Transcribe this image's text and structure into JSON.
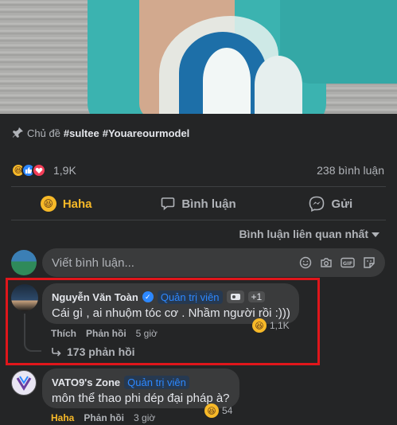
{
  "post": {
    "topic_label": "Chủ đề",
    "tags": [
      "#sultee",
      "#Youareourmodel"
    ],
    "reaction_count": "1,9K",
    "comment_count": "238 bình luận",
    "reaction_icons": [
      "haha-icon",
      "like-icon",
      "love-icon"
    ]
  },
  "actions": {
    "haha": "Haha",
    "comment": "Bình luận",
    "send": "Gửi"
  },
  "sort": {
    "label": "Bình luận liên quan nhất"
  },
  "compose": {
    "placeholder": "Viết bình luận..."
  },
  "comments": [
    {
      "author": "Nguyễn Văn Toàn",
      "verified": true,
      "role": "Quản trị viên",
      "extra_badges": "+1",
      "text": "Cái gì , ai nhuộm tóc cơ . Nhầm người rồi :)))",
      "reaction_count": "1,1K",
      "like_label": "Thích",
      "reply_label": "Phản hồi",
      "time": "5 giờ",
      "replies": "173 phản hồi"
    },
    {
      "author": "VATO9's Zone",
      "role": "Quản trị viên",
      "text": "môn thể thao phi dép đại pháp à?",
      "reaction_count": "54",
      "like_label": "Haha",
      "reply_label": "Phản hồi",
      "time": "3 giờ"
    }
  ],
  "colors": {
    "background": "#242526",
    "bubble": "#3a3b3c",
    "haha": "#f7b928",
    "link_blue": "#2d88ff",
    "highlight": "#e0161b"
  }
}
